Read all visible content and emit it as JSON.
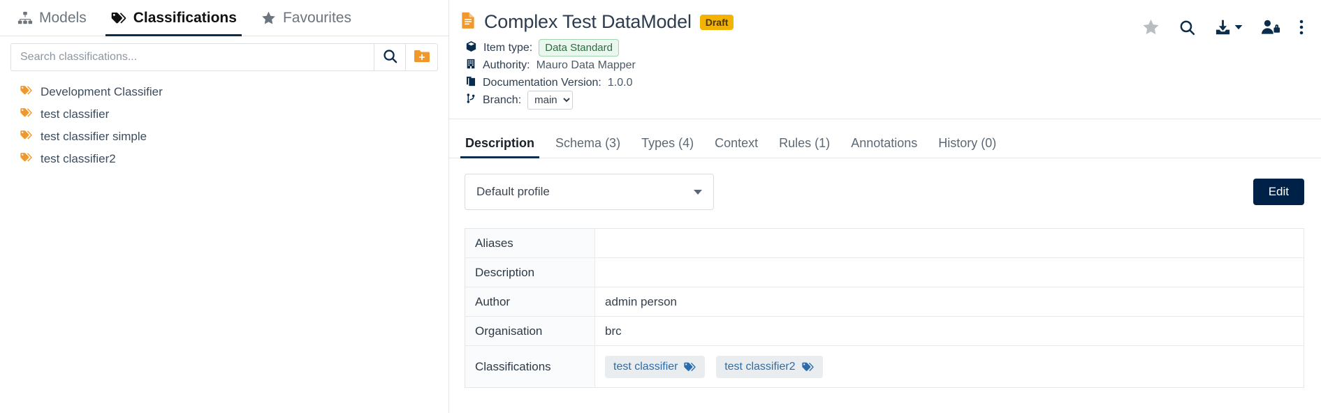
{
  "sidebar": {
    "tabs": [
      {
        "label": "Models",
        "icon": "sitemap-icon",
        "active": false
      },
      {
        "label": "Classifications",
        "icon": "tag-icon",
        "active": true
      },
      {
        "label": "Favourites",
        "icon": "star-icon",
        "active": false
      }
    ],
    "search": {
      "placeholder": "Search classifications...",
      "value": "",
      "search_button_icon": "search-icon",
      "add_button_icon": "add-folder-icon"
    },
    "items": [
      {
        "label": "Development Classifier",
        "icon": "tag-icon"
      },
      {
        "label": "test classifier",
        "icon": "tag-icon"
      },
      {
        "label": "test classifier simple",
        "icon": "tag-icon"
      },
      {
        "label": "test classifier2",
        "icon": "tag-icon"
      }
    ]
  },
  "detail": {
    "title": "Complex Test DataModel",
    "title_icon": "document-icon",
    "status_badge": "Draft",
    "meta": {
      "item_type_label": "Item type:",
      "item_type_value": "Data Standard",
      "item_type_icon": "cube-icon",
      "authority_label": "Authority:",
      "authority_value": "Mauro Data Mapper",
      "authority_icon": "building-icon",
      "doc_version_label": "Documentation Version:",
      "doc_version_value": "1.0.0",
      "doc_version_icon": "copy-icon",
      "branch_label": "Branch:",
      "branch_value": "main",
      "branch_icon": "branch-icon",
      "branch_options": [
        "main"
      ]
    },
    "actions": [
      {
        "name": "favourite-star-icon",
        "title": "Favourite"
      },
      {
        "name": "search-icon",
        "title": "Search"
      },
      {
        "name": "download-icon",
        "title": "Export"
      },
      {
        "name": "user-lock-icon",
        "title": "Permissions"
      },
      {
        "name": "more-vertical-icon",
        "title": "More"
      }
    ],
    "tabs": [
      {
        "label": "Description",
        "active": true
      },
      {
        "label": "Schema (3)",
        "active": false
      },
      {
        "label": "Types (4)",
        "active": false
      },
      {
        "label": "Context",
        "active": false
      },
      {
        "label": "Rules (1)",
        "active": false
      },
      {
        "label": "Annotations",
        "active": false
      },
      {
        "label": "History (0)",
        "active": false
      }
    ],
    "profile_select": {
      "value": "Default profile",
      "options": [
        "Default profile"
      ]
    },
    "edit_button": "Edit",
    "table": [
      {
        "key": "Aliases",
        "value": "",
        "type": "text"
      },
      {
        "key": "Description",
        "value": "",
        "type": "text"
      },
      {
        "key": "Author",
        "value": "admin person",
        "type": "text"
      },
      {
        "key": "Organisation",
        "value": "brc",
        "type": "text"
      },
      {
        "key": "Classifications",
        "value": "",
        "type": "chips",
        "chips": [
          "test classifier",
          "test classifier2"
        ]
      }
    ]
  },
  "colors": {
    "accent_navy": "#002147",
    "tag_orange": "#f0982d",
    "badge_yellow": "#f5b301",
    "chip_green_bg": "#eaf7ee",
    "chip_blue_text": "#2c6ca8"
  }
}
